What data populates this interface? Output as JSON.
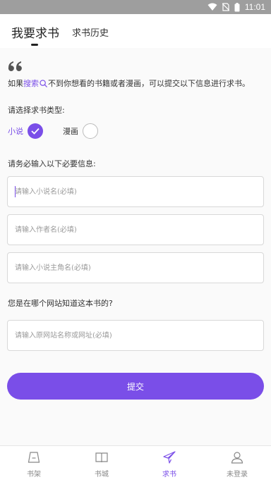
{
  "status_bar": {
    "time": "11:01"
  },
  "header": {
    "tabs": [
      {
        "label": "我要求书",
        "active": true
      },
      {
        "label": "求书历史",
        "active": false
      }
    ]
  },
  "intro": {
    "prefix": "如果",
    "link": "搜索",
    "suffix": "不到你想看的书籍或者漫画，可以提交以下信息进行求书。"
  },
  "type_section": {
    "label": "请选择求书类型:",
    "options": [
      {
        "label": "小说",
        "selected": true
      },
      {
        "label": "漫画",
        "selected": false
      }
    ]
  },
  "required_label": "请务必输入以下必要信息:",
  "fields": {
    "novel_name": {
      "placeholder": "请输入小说名(必填)",
      "value": ""
    },
    "author_name": {
      "placeholder": "请输入作者名(必填)",
      "value": ""
    },
    "protagonist_name": {
      "placeholder": "请输入小说主角名(必填)",
      "value": ""
    }
  },
  "source_label": "您是在哪个网站知道这本书的?",
  "source_field": {
    "placeholder": "请输入原网站名称或网址(必填)",
    "value": ""
  },
  "submit_label": "提交",
  "nav": {
    "items": [
      {
        "label": "书架",
        "icon": "bookshelf-icon"
      },
      {
        "label": "书城",
        "icon": "book-icon"
      },
      {
        "label": "求书",
        "icon": "paper-plane-icon",
        "active": true
      },
      {
        "label": "未登录",
        "icon": "user-icon"
      }
    ]
  },
  "colors": {
    "accent": "#7a4ee8",
    "status_bar": "#9e9e9e"
  }
}
